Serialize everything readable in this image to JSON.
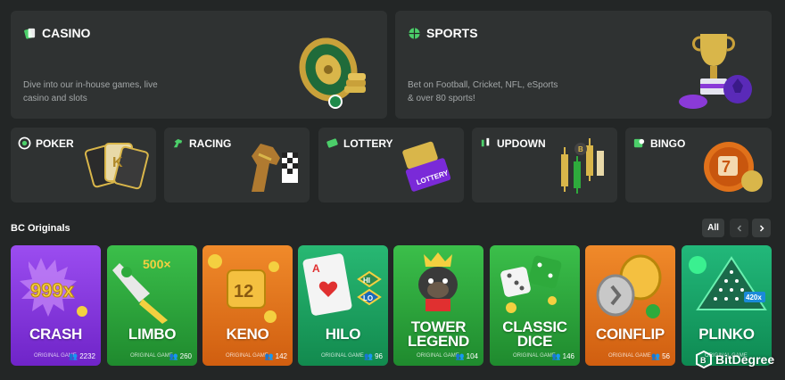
{
  "hero": [
    {
      "title": "CASINO",
      "description": "Dive into our in-house games, live casino and slots",
      "icon": "cards-icon"
    },
    {
      "title": "SPORTS",
      "description": "Bet on Football, Cricket, NFL, eSports & over 80 sports!",
      "icon": "ball-icon"
    }
  ],
  "categories": [
    {
      "title": "POKER",
      "icon": "chip-icon"
    },
    {
      "title": "RACING",
      "icon": "horse-icon"
    },
    {
      "title": "LOTTERY",
      "icon": "ticket-icon"
    },
    {
      "title": "UPDOWN",
      "icon": "candlestick-icon"
    },
    {
      "title": "BINGO",
      "icon": "bingo-icon"
    }
  ],
  "originals": {
    "title": "BC Originals",
    "all_label": "All",
    "prev_icon": "chevron-left-icon",
    "next_icon": "chevron-right-icon",
    "games": [
      {
        "name": "CRASH",
        "subtitle": "ORIGINAL GAME",
        "players": "2232",
        "color": "#8a2be2"
      },
      {
        "name": "LIMBO",
        "subtitle": "ORIGINAL GAME",
        "players": "260",
        "color": "#2eaa3c"
      },
      {
        "name": "KENO",
        "subtitle": "ORIGINAL GAME",
        "players": "142",
        "color": "#e0711a"
      },
      {
        "name": "HILO",
        "subtitle": "ORIGINAL GAME",
        "players": "96",
        "color": "#1aa35f"
      },
      {
        "name": "TOWER LEGEND",
        "subtitle": "ORIGINAL GAME",
        "players": "104",
        "color": "#29a83a"
      },
      {
        "name": "CLASSIC DICE",
        "subtitle": "ORIGINAL GAME",
        "players": "146",
        "color": "#27a335"
      },
      {
        "name": "COINFLIP",
        "subtitle": "ORIGINAL GAME",
        "players": "56",
        "color": "#e06a18"
      },
      {
        "name": "PLINKO",
        "subtitle": "ORIGINAL GAME",
        "players": "—",
        "color": "#18a366"
      }
    ]
  },
  "watermark": {
    "text": "BitDegree"
  }
}
